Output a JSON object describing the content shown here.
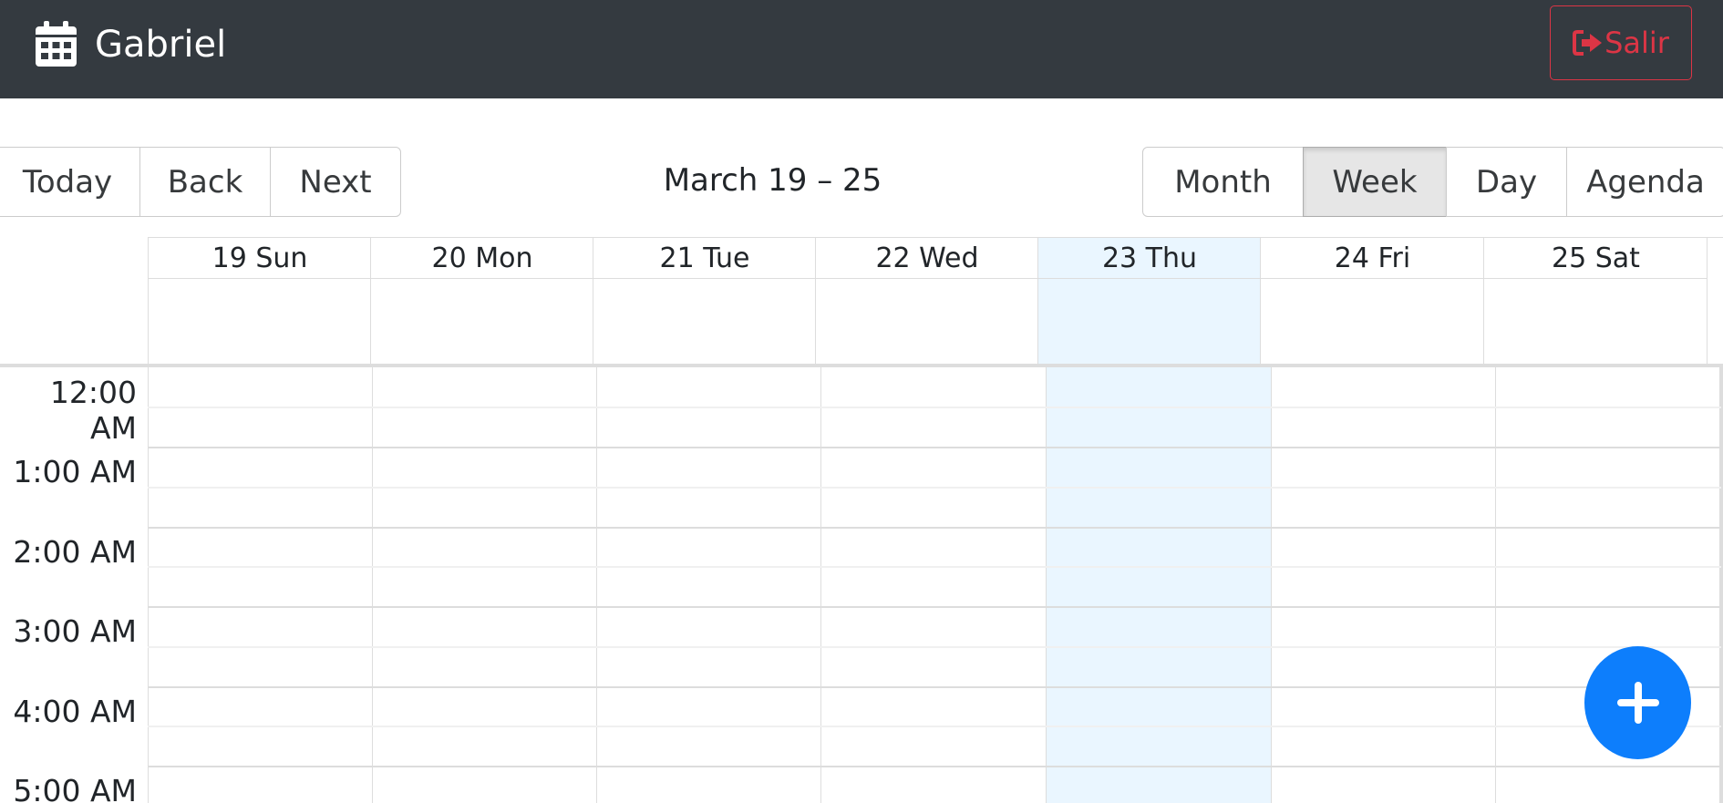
{
  "navbar": {
    "brand_icon": "calendar-icon",
    "user_name": "Gabriel",
    "logout": {
      "icon": "sign-out-icon",
      "label": "Salir",
      "color": "#dc3545"
    },
    "background": "#343a40"
  },
  "toolbar": {
    "nav_buttons": [
      "Today",
      "Back",
      "Next"
    ],
    "range_label": "March 19 – 25",
    "views": [
      "Month",
      "Week",
      "Day",
      "Agenda"
    ],
    "active_view": "Week"
  },
  "calendar": {
    "days": [
      "19 Sun",
      "20 Mon",
      "21 Tue",
      "22 Wed",
      "23 Thu",
      "24 Fri",
      "25 Sat"
    ],
    "today": "23 Thu",
    "today_color": "#eaf6ff",
    "time_slots": [
      "12:00 AM",
      "1:00 AM",
      "2:00 AM",
      "3:00 AM",
      "4:00 AM",
      "5:00 AM"
    ]
  },
  "fab": {
    "icon": "plus-icon",
    "color": "#0d7efc"
  }
}
